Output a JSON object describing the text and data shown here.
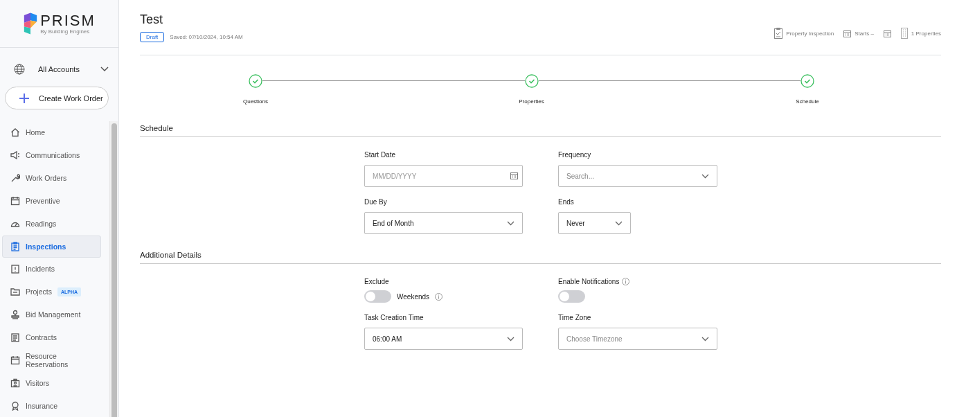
{
  "sidebar": {
    "logo": {
      "name": "PRISM",
      "tagline": "By Building Engines"
    },
    "account": "All Accounts",
    "create_button": "Create Work Order",
    "items": [
      {
        "label": "Home",
        "selected": false
      },
      {
        "label": "Communications",
        "selected": false
      },
      {
        "label": "Work Orders",
        "selected": false
      },
      {
        "label": "Preventive",
        "selected": false
      },
      {
        "label": "Readings",
        "selected": false
      },
      {
        "label": "Inspections",
        "selected": true
      },
      {
        "label": "Incidents",
        "selected": false
      },
      {
        "label": "Projects",
        "selected": false,
        "badge": "ALPHA"
      },
      {
        "label": "Bid Management",
        "selected": false
      },
      {
        "label": "Contracts",
        "selected": false
      },
      {
        "label": "Resource Reservations",
        "selected": false
      },
      {
        "label": "Visitors",
        "selected": false
      },
      {
        "label": "Insurance",
        "selected": false
      }
    ]
  },
  "header": {
    "title": "Test",
    "status": "Draft",
    "saved": "Saved: 07/10/2024, 10:54 AM",
    "meta": [
      {
        "kind": "type",
        "text": "Property Inspection"
      },
      {
        "kind": "start",
        "text": "Starts –"
      },
      {
        "kind": "end"
      },
      {
        "kind": "properties",
        "text": "1 Properties"
      }
    ]
  },
  "steps": [
    {
      "label": "Questions",
      "done": true
    },
    {
      "label": "Properties",
      "done": true
    },
    {
      "label": "Schedule",
      "done": true
    }
  ],
  "sections": [
    {
      "title": "Schedule",
      "fields": [
        {
          "kind": "date",
          "label": "Start Date",
          "placeholder": "MM/DD/YYYY"
        },
        {
          "kind": "select",
          "label": "Frequency",
          "placeholder": "Search..."
        },
        {
          "kind": "select",
          "label": "Due By",
          "value": "End of Month"
        },
        {
          "kind": "select",
          "label": "Ends",
          "value": "Never",
          "narrow": true
        }
      ]
    },
    {
      "title": "Additional Details",
      "fields": [
        {
          "kind": "toggle",
          "label": "Exclude",
          "toggle_label": "Weekends",
          "on": false
        },
        {
          "kind": "toggle",
          "label": "Enable Notifications",
          "info": true,
          "on": false
        },
        {
          "kind": "select",
          "label": "Task Creation Time",
          "value": "06:00 AM"
        },
        {
          "kind": "select",
          "label": "Time Zone",
          "placeholder": "Choose Timezone"
        }
      ]
    }
  ]
}
